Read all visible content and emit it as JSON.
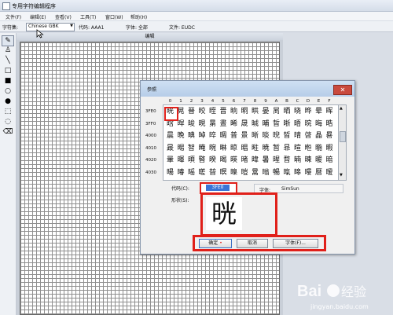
{
  "window": {
    "title": "专用字符编辑程序"
  },
  "menu": [
    "文件(F)",
    "编辑(E)",
    "查看(V)",
    "工具(T)",
    "窗口(W)",
    "帮助(H)"
  ],
  "info": {
    "charset_label": "字符集:",
    "charset_value": "Chinese GBK",
    "code_text": "代码: AAA1",
    "font_text": "字体: 全部",
    "file_text": "文件: EUDC"
  },
  "editor": {
    "title": "编辑"
  },
  "tools": [
    {
      "name": "pencil-tool",
      "glyph": "✎"
    },
    {
      "name": "brush-tool",
      "glyph": "♙"
    },
    {
      "name": "line-tool",
      "glyph": "╲"
    },
    {
      "name": "hollow-rectangle-tool",
      "glyph": "□"
    },
    {
      "name": "filled-rectangle-tool",
      "glyph": "■"
    },
    {
      "name": "hollow-ellipse-tool",
      "glyph": "○"
    },
    {
      "name": "filled-ellipse-tool",
      "glyph": "●"
    },
    {
      "name": "rect-select-tool",
      "glyph": "⬚"
    },
    {
      "name": "freeform-select-tool",
      "glyph": "◌"
    },
    {
      "name": "eraser-tool",
      "glyph": "⌫"
    }
  ],
  "dialog": {
    "title": "参照",
    "close_glyph": "✕",
    "col_headers": [
      "0",
      "1",
      "2",
      "3",
      "4",
      "5",
      "6",
      "7",
      "8",
      "9",
      "A",
      "B",
      "C",
      "D",
      "E",
      "F"
    ],
    "row_headers": [
      "3FE0",
      "3FF0",
      "4000",
      "4010",
      "4020",
      "4030"
    ],
    "rows": [
      [
        "晄",
        "晃",
        "晉",
        "晈",
        "晊",
        "晋",
        "晌",
        "晍",
        "晎",
        "晏",
        "晑",
        "晒",
        "晓",
        "晔",
        "晕",
        "晖"
      ],
      [
        "晗",
        "晘",
        "晙",
        "晛",
        "晜",
        "晝",
        "晞",
        "晟",
        "晠",
        "晡",
        "晢",
        "晣",
        "晤",
        "晥",
        "晦",
        "晧"
      ],
      [
        "晨",
        "晩",
        "晪",
        "晫",
        "晬",
        "晭",
        "普",
        "景",
        "晰",
        "晱",
        "晲",
        "晳",
        "晴",
        "晵",
        "晶",
        "晷"
      ],
      [
        "晸",
        "晹",
        "智",
        "晻",
        "晼",
        "晽",
        "晾",
        "晿",
        "暀",
        "暁",
        "暂",
        "暃",
        "暄",
        "暅",
        "暆",
        "暇"
      ],
      [
        "暈",
        "暉",
        "暊",
        "暋",
        "暌",
        "暍",
        "暎",
        "暏",
        "暐",
        "暑",
        "暒",
        "暓",
        "暔",
        "暕",
        "暖",
        "暗"
      ],
      [
        "暘",
        "暙",
        "暚",
        "暛",
        "暜",
        "暝",
        "暞",
        "暟",
        "暠",
        "暡",
        "暢",
        "暣",
        "暤",
        "暥",
        "暦",
        "暧"
      ]
    ],
    "code_label": "代码(C):",
    "code_value": "3FE0",
    "font_label": "字体:",
    "font_value": "SimSun",
    "shape_label": "形状(S):",
    "shape_char": "晄",
    "ok_label": "确定",
    "cancel_label": "取消",
    "font_button_label": "字体(F)...",
    "scroll_up": "▲",
    "scroll_down": "▼"
  },
  "watermark": {
    "url": "jingyan.baidu.com"
  },
  "colors": {
    "highlight": "#e0201a",
    "selection": "#3a74d6"
  }
}
